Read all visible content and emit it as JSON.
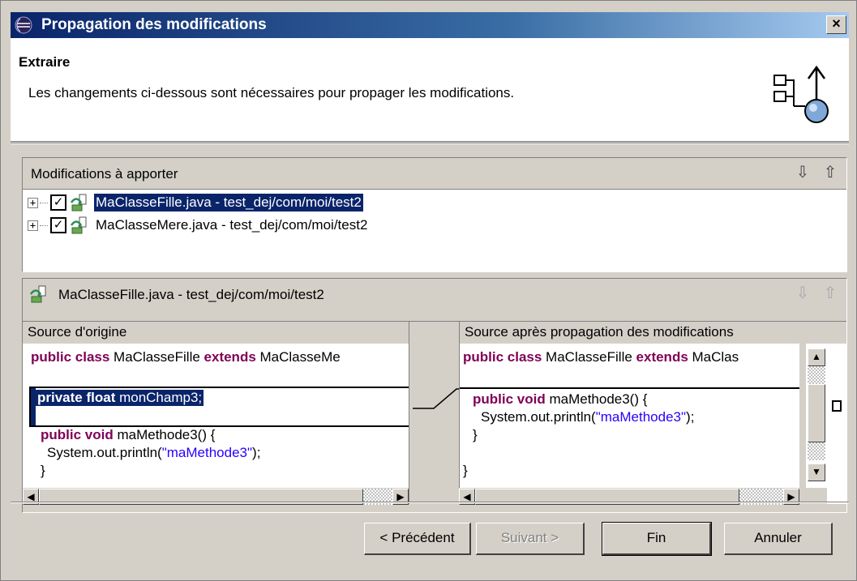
{
  "window": {
    "title": "Propagation des modifications",
    "close_label": "×"
  },
  "header": {
    "title": "Extraire",
    "description": "Les changements ci-dessous sont nécessaires pour propager les modifications."
  },
  "changes_panel": {
    "label": "Modifications à apporter",
    "nav_down": "⇩",
    "nav_up": "⇧",
    "items": [
      {
        "label": "MaClasseFille.java - test_dej/com/moi/test2",
        "checked": "✓",
        "expander": "+",
        "selected": true
      },
      {
        "label": "MaClasseMere.java - test_dej/com/moi/test2",
        "checked": "✓",
        "expander": "+",
        "selected": false
      }
    ]
  },
  "compare_panel": {
    "label": "MaClasseFille.java - test_dej/com/moi/test2",
    "nav_down": "⇩",
    "nav_up": "⇧",
    "left_title": "Source d'origine",
    "right_title": "Source après propagation des modifications",
    "left_code": {
      "line1_kw": "public class",
      "line1_mid": " MaClasseFille ",
      "line1_kw2": "extends",
      "line1_tail": " MaClasseMe",
      "sel_kw": "private float",
      "sel_tail": " monChamp3;",
      "m_kw": "public void",
      "m_tail": " maMethode3() {",
      "print_pre": "System.out.println(",
      "print_str": "\"maMethode3\"",
      "print_post": ");",
      "close": "}"
    },
    "right_code": {
      "line1_kw": "public class",
      "line1_mid": " MaClasseFille ",
      "line1_kw2": "extends",
      "line1_tail": " MaClas",
      "m_kw": "public void",
      "m_tail": " maMethode3() {",
      "print_pre": "System.out.println(",
      "print_str": "\"maMethode3\"",
      "print_post": ");",
      "close": "}",
      "close2": "}"
    }
  },
  "buttons": {
    "previous": "< Précédent",
    "next": "Suivant >",
    "finish": "Fin",
    "cancel": "Annuler"
  },
  "colors": {
    "titlebar": "#0a246a",
    "keyword": "#7f0055",
    "string": "#2a00ff",
    "selection": "#0a246a"
  }
}
